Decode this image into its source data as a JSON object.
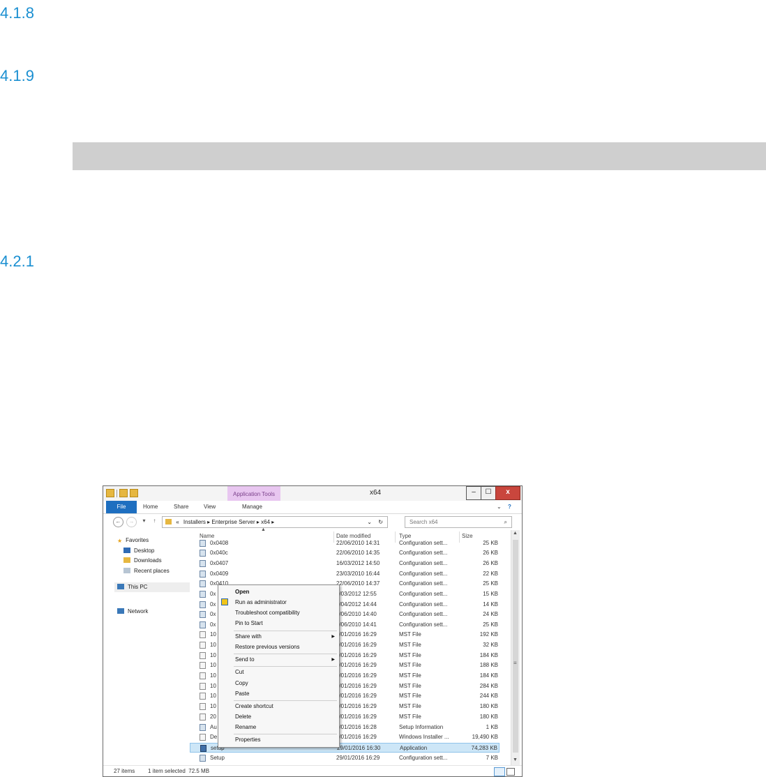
{
  "headings": [
    "4.1.8",
    "4.1.9",
    "4.2.1"
  ],
  "window": {
    "title": "x64",
    "context_tab": "Application Tools",
    "ribbon_tabs": [
      "File",
      "Home",
      "Share",
      "View",
      "Manage"
    ],
    "address": {
      "prefix": "«",
      "segments": [
        "Installers",
        "Enterprise Server",
        "x64"
      ]
    },
    "search_placeholder": "Search x64",
    "nav": {
      "favorites": "Favorites",
      "desktop": "Desktop",
      "downloads": "Downloads",
      "recent": "Recent places",
      "this_pc": "This PC",
      "network": "Network"
    },
    "columns": [
      "Name",
      "Date modified",
      "Type",
      "Size"
    ],
    "rows": [
      {
        "name": "0x0408",
        "date": "22/06/2010 14:31",
        "type": "Configuration sett...",
        "size": "25 KB",
        "icon": "gear"
      },
      {
        "name": "0x040c",
        "date": "22/06/2010 14:35",
        "type": "Configuration sett...",
        "size": "26 KB",
        "icon": "gear"
      },
      {
        "name": "0x0407",
        "date": "16/03/2012 14:50",
        "type": "Configuration sett...",
        "size": "26 KB",
        "icon": "gear"
      },
      {
        "name": "0x0409",
        "date": "23/03/2010 16:44",
        "type": "Configuration sett...",
        "size": "22 KB",
        "icon": "gear"
      },
      {
        "name": "0x0410",
        "date": "22/06/2010 14:37",
        "type": "Configuration sett...",
        "size": "25 KB",
        "icon": "gear"
      },
      {
        "name": "0x",
        "date": "6/03/2012 12:55",
        "type": "Configuration sett...",
        "size": "15 KB",
        "icon": "gear"
      },
      {
        "name": "0x",
        "date": "3/04/2012 14:44",
        "type": "Configuration sett...",
        "size": "14 KB",
        "icon": "gear"
      },
      {
        "name": "0x",
        "date": "2/06/2010 14:40",
        "type": "Configuration sett...",
        "size": "24 KB",
        "icon": "gear"
      },
      {
        "name": "0x",
        "date": "2/06/2010 14:41",
        "type": "Configuration sett...",
        "size": "25 KB",
        "icon": "gear"
      },
      {
        "name": "10",
        "date": "9/01/2016 16:29",
        "type": "MST File",
        "size": "192 KB",
        "icon": "file"
      },
      {
        "name": "10",
        "date": "9/01/2016 16:29",
        "type": "MST File",
        "size": "32 KB",
        "icon": "file"
      },
      {
        "name": "10",
        "date": "9/01/2016 16:29",
        "type": "MST File",
        "size": "184 KB",
        "icon": "file"
      },
      {
        "name": "10",
        "date": "9/01/2016 16:29",
        "type": "MST File",
        "size": "188 KB",
        "icon": "file"
      },
      {
        "name": "10",
        "date": "9/01/2016 16:29",
        "type": "MST File",
        "size": "184 KB",
        "icon": "file"
      },
      {
        "name": "10",
        "date": "9/01/2016 16:29",
        "type": "MST File",
        "size": "284 KB",
        "icon": "file"
      },
      {
        "name": "10",
        "date": "9/01/2016 16:29",
        "type": "MST File",
        "size": "244 KB",
        "icon": "file"
      },
      {
        "name": "10",
        "date": "9/01/2016 16:29",
        "type": "MST File",
        "size": "180 KB",
        "icon": "file"
      },
      {
        "name": "20",
        "date": "9/01/2016 16:29",
        "type": "MST File",
        "size": "180 KB",
        "icon": "file"
      },
      {
        "name": "Au",
        "date": "9/01/2016 16:28",
        "type": "Setup Information",
        "size": "1 KB",
        "icon": "gear"
      },
      {
        "name": "De",
        "date": "9/01/2016 16:29",
        "type": "Windows Installer ...",
        "size": "19,490 KB",
        "icon": "file"
      },
      {
        "name": "setup",
        "date": "29/01/2016 16:30",
        "type": "Application",
        "size": "74,283 KB",
        "icon": "app",
        "selected": true
      },
      {
        "name": "Setup",
        "date": "29/01/2016 16:29",
        "type": "Configuration sett...",
        "size": "7 KB",
        "icon": "gear"
      }
    ],
    "status": {
      "items": "27 items",
      "selected": "1 item selected  72.5 MB"
    }
  },
  "context_menu": {
    "group1": [
      "Open",
      "Run as administrator",
      "Troubleshoot compatibility",
      "Pin to Start"
    ],
    "group2": [
      "Share with",
      "Restore previous versions"
    ],
    "group3": [
      "Send to"
    ],
    "group4": [
      "Cut",
      "Copy",
      "Paste"
    ],
    "group5": [
      "Create shortcut",
      "Delete",
      "Rename"
    ],
    "group6": [
      "Properties"
    ]
  }
}
